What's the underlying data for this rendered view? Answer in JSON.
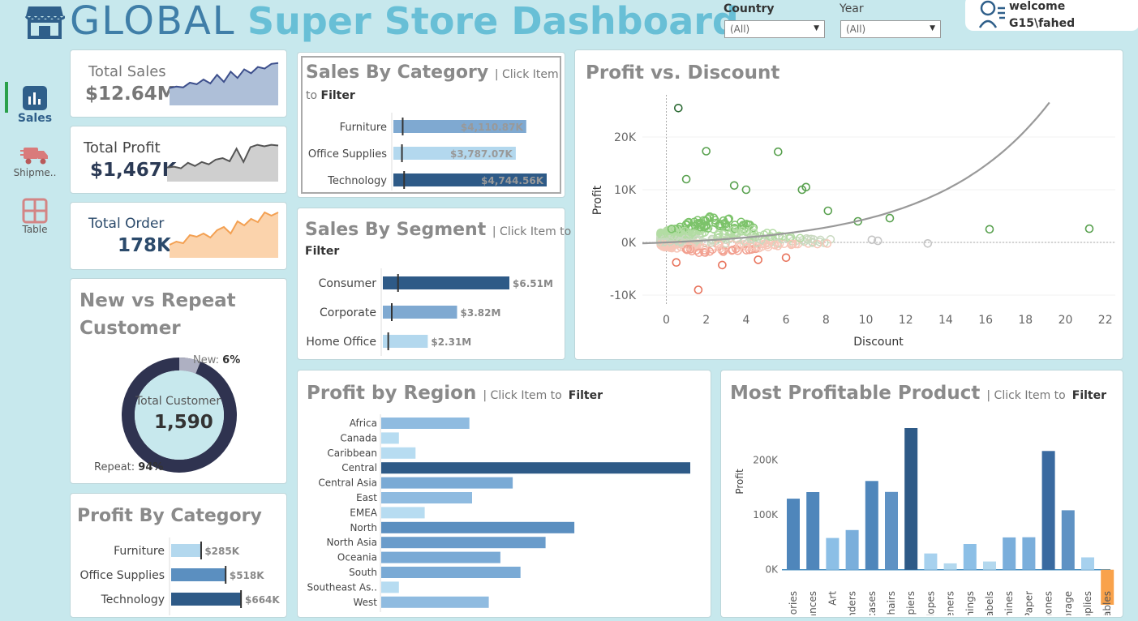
{
  "header": {
    "brand": "GLOBAL",
    "title": "Super Store Dashboard",
    "filters": [
      {
        "label": "Country",
        "value": "(All)"
      },
      {
        "label": "Year",
        "value": "(All)"
      }
    ],
    "user": {
      "greeting": "welcome",
      "name": "G15\\fahed"
    }
  },
  "nav": [
    {
      "label": "Sales",
      "icon": "bar-chart-icon",
      "active": true
    },
    {
      "label": "Shipme..",
      "icon": "truck-icon",
      "active": false
    },
    {
      "label": "Table",
      "icon": "table-icon",
      "active": false
    }
  ],
  "colors": {
    "background": "#c7e8ed",
    "dark_blue": "#2e5a87",
    "mid_blue": "#5b8fc0",
    "light_blue": "#a9d0ea",
    "orange": "#f9a24b",
    "green": "#59a14f",
    "red": "#e8735c"
  },
  "kpis": [
    {
      "label": "Total Sales",
      "value": "$12.64M",
      "spark": [
        22,
        24,
        23,
        29,
        27,
        33,
        28,
        39,
        30,
        43,
        35,
        46,
        41,
        49,
        47,
        53,
        54
      ],
      "color": "#aebfd8",
      "stroke": "#3d4f8c"
    },
    {
      "label": "Total Profit",
      "value": "$1,467K",
      "spark": [
        18,
        19,
        17,
        24,
        20,
        25,
        22,
        28,
        30,
        26,
        42,
        25,
        44,
        47,
        45,
        47,
        46
      ],
      "color": "#cfcfcf",
      "stroke": "#555555"
    },
    {
      "label": "Total Order",
      "value": "178K",
      "spark": [
        16,
        20,
        18,
        28,
        26,
        30,
        25,
        34,
        38,
        30,
        45,
        40,
        48,
        44,
        56,
        52,
        56
      ],
      "color": "#fbd3ac",
      "stroke": "#f3a052"
    }
  ],
  "customers": {
    "title_line1": "New vs Repeat",
    "title_line2": "Customer",
    "new_label": "New:",
    "new_pct_text": "6%",
    "new_pct": 6,
    "repeat_label": "Repeat:",
    "repeat_pct_text": "94%",
    "repeat_pct": 94,
    "center_label": "Total Customer",
    "center_value": "1,590"
  },
  "sales_by_category": {
    "title": "Sales By Category",
    "hint": "| Click Item",
    "hint2": "to",
    "hint_bold": "Filter",
    "rows": [
      {
        "label": "Furniture",
        "value": 4110.87,
        "text": "$4,110.87K",
        "color": "#7fa9d1"
      },
      {
        "label": "Office Supplies",
        "value": 3787.07,
        "text": "$3,787.07K",
        "color": "#b3d8ee"
      },
      {
        "label": "Technology",
        "value": 4744.56,
        "text": "$4,744.56K",
        "color": "#2e5a87"
      }
    ]
  },
  "sales_by_segment": {
    "title": "Sales By Segment",
    "hint": "| Click Item to",
    "hint_bold": "Filter",
    "rows": [
      {
        "label": "Consumer",
        "value": 6.51,
        "text": "$6.51M",
        "color": "#2e5a87"
      },
      {
        "label": "Corporate",
        "value": 3.82,
        "text": "$3.82M",
        "color": "#7fa9d1"
      },
      {
        "label": "Home Office",
        "value": 2.31,
        "text": "$2.31M",
        "color": "#b3d8ee"
      }
    ]
  },
  "profit_by_category": {
    "title": "Profit By Category",
    "rows": [
      {
        "label": "Furniture",
        "value": 285,
        "text": "$285K",
        "color": "#b3d8ee"
      },
      {
        "label": "Office Supplies",
        "value": 518,
        "text": "$518K",
        "color": "#5b8fc0"
      },
      {
        "label": "Technology",
        "value": 664,
        "text": "$664K",
        "color": "#2e5a87"
      }
    ]
  },
  "profit_vs_discount": {
    "title": "Profit vs. Discount",
    "xlabel": "Discount",
    "ylabel": "Profit",
    "xticks": [
      "0",
      "2",
      "4",
      "6",
      "8",
      "10",
      "12",
      "14",
      "16",
      "18",
      "20",
      "22"
    ],
    "yticks": [
      "20K",
      "10K",
      "0K",
      "-10K"
    ]
  },
  "profit_by_region": {
    "title": "Profit by Region",
    "hint": "| Click Item to",
    "hint_bold": "Filter"
  },
  "most_profitable": {
    "title": "Most Profitable Product",
    "hint": "| Click Item to",
    "hint_bold": "Filter",
    "ylabel": "Profit",
    "yticks": [
      "200K",
      "100K",
      "0K"
    ]
  },
  "chart_data": [
    {
      "type": "scatter",
      "title": "Profit vs. Discount",
      "xlabel": "Discount",
      "ylabel": "Profit",
      "xlim": [
        -1.2,
        22.5
      ],
      "ylim": [
        -12000,
        28000
      ],
      "trend": "exponential",
      "highlight_points": [
        {
          "x": 0.6,
          "y": 25500
        },
        {
          "x": 2.0,
          "y": 17300
        },
        {
          "x": 5.6,
          "y": 17200
        },
        {
          "x": 1.0,
          "y": 12000
        },
        {
          "x": 3.4,
          "y": 10800
        },
        {
          "x": 4.0,
          "y": 10000
        },
        {
          "x": 6.8,
          "y": 10000
        },
        {
          "x": 7.0,
          "y": 10500
        },
        {
          "x": 8.1,
          "y": 6000
        },
        {
          "x": 9.6,
          "y": 4000
        },
        {
          "x": 11.2,
          "y": 4600
        },
        {
          "x": 16.2,
          "y": 2500
        },
        {
          "x": 21.2,
          "y": 2600
        },
        {
          "x": 13.1,
          "y": -200
        },
        {
          "x": 1.6,
          "y": -9000
        },
        {
          "x": 0.5,
          "y": -3800
        },
        {
          "x": 2.8,
          "y": -4300
        },
        {
          "x": 4.6,
          "y": -3300
        },
        {
          "x": 6.0,
          "y": -2900
        },
        {
          "x": 10.3,
          "y": 500
        },
        {
          "x": 10.6,
          "y": 300
        }
      ]
    },
    {
      "type": "bar",
      "orientation": "horizontal",
      "title": "Profit by Region",
      "categories": [
        "Africa",
        "Canada",
        "Caribbean",
        "Central",
        "Central Asia",
        "East",
        "EMEA",
        "North",
        "North Asia",
        "Oceania",
        "South",
        "Southeast As..",
        "West"
      ],
      "values": [
        88871,
        17817,
        34572,
        311404,
        132481,
        91523,
        43846,
        194597,
        165579,
        120089,
        140356,
        17852,
        108418
      ],
      "colors": [
        "#8fbbe0",
        "#b7dcf1",
        "#b7dcf1",
        "#2e5a87",
        "#7aaad5",
        "#8fbbe0",
        "#b7dcf1",
        "#5b8fc0",
        "#6a9ccb",
        "#7aaad5",
        "#7aaad5",
        "#b7dcf1",
        "#8fbbe0"
      ]
    },
    {
      "type": "bar",
      "title": "Most Profitable Product",
      "ylabel": "Profit",
      "ylim": [
        -30000,
        260000
      ],
      "categories": [
        "Accessories",
        "Appliances",
        "Art",
        "Binders",
        "Bookcases",
        "Chairs",
        "Copiers",
        "Envelopes",
        "Fasteners",
        "Furnishings",
        "Labels",
        "Machines",
        "Paper",
        "Phones",
        "Storage",
        "Supplies",
        "Tables"
      ],
      "values": [
        129626,
        141680,
        57954,
        72449,
        161925,
        141973,
        258567,
        29602,
        11525,
        46968,
        15010,
        58868,
        59207,
        216717,
        108461,
        22583,
        -64083
      ],
      "colors": [
        "#4f86bb",
        "#4f86bb",
        "#8cbfe6",
        "#7aaedb",
        "#4f86bb",
        "#5f92c4",
        "#2e5a87",
        "#a7d1ee",
        "#b3d8ee",
        "#8cbfe6",
        "#b3d8ee",
        "#7aaedb",
        "#7aaedb",
        "#3a6aa0",
        "#5f92c4",
        "#a7d1ee",
        "#f9a24b"
      ]
    }
  ]
}
